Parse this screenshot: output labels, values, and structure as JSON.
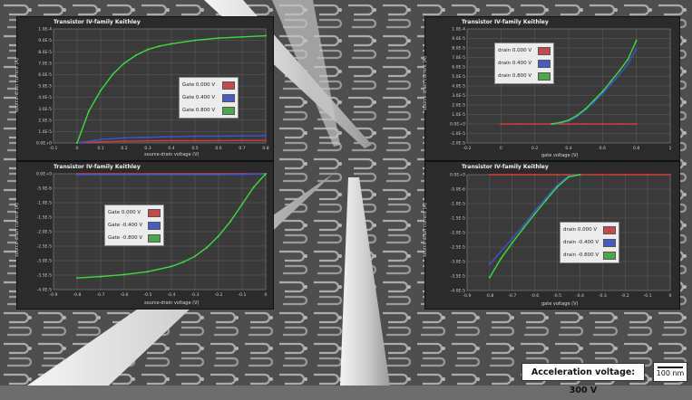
{
  "overlay": {
    "acceleration_label": "Acceleration voltage: 300 V",
    "scale_label": "100 nm"
  },
  "colors": {
    "red": "#d43a3a",
    "blue": "#3b55d6",
    "green": "#3ddc3d",
    "panel_bg": "#2b2b2b",
    "grid": "#6a6a6a"
  },
  "chart_data": [
    {
      "type": "scatter",
      "title": "Transistor IV-family Keithley",
      "xlabel": "source-drain voltage (V)",
      "ylabel": "source-drain current (A)",
      "xlim": [
        -0.1,
        0.8
      ],
      "ylim": [
        0,
        0.0001
      ],
      "xticks": [
        "-0.1",
        "0",
        "0.1",
        "0.2",
        "0.3",
        "0.4",
        "0.5",
        "0.6",
        "0.7",
        "0.8"
      ],
      "yticks": [
        "0.0E+0",
        "1.0E-5",
        "2.0E-5",
        "3.0E-5",
        "4.0E-5",
        "5.0E-5",
        "6.0E-5",
        "7.0E-5",
        "8.0E-5",
        "9.0E-5",
        "1.0E-4"
      ],
      "legend_position": "center-right",
      "series": [
        {
          "name": "Gate 0.000 V",
          "color": "red",
          "x": [
            0,
            0.1,
            0.2,
            0.3,
            0.4,
            0.5,
            0.6,
            0.7,
            0.8
          ],
          "y": [
            0,
            1e-06,
            1.5e-06,
            1.8e-06,
            2e-06,
            2e-06,
            2.1e-06,
            2.2e-06,
            2.2e-06
          ]
        },
        {
          "name": "Gate 0.400 V",
          "color": "blue",
          "x": [
            0,
            0.1,
            0.2,
            0.3,
            0.4,
            0.5,
            0.6,
            0.7,
            0.8
          ],
          "y": [
            0,
            3e-06,
            4.5e-06,
            5e-06,
            5.5e-06,
            6e-06,
            6e-06,
            6.2e-06,
            6.4e-06
          ]
        },
        {
          "name": "Gate 0.800 V",
          "color": "green",
          "x": [
            0,
            0.05,
            0.1,
            0.15,
            0.2,
            0.25,
            0.3,
            0.35,
            0.4,
            0.5,
            0.6,
            0.7,
            0.8
          ],
          "y": [
            0,
            2.8e-05,
            4.6e-05,
            6e-05,
            7e-05,
            7.7e-05,
            8.2e-05,
            8.5e-05,
            8.7e-05,
            9e-05,
            9.2e-05,
            9.3e-05,
            9.4e-05
          ]
        }
      ]
    },
    {
      "type": "scatter",
      "title": "Transistor IV-family Keithley",
      "xlabel": "gate voltage (V)",
      "ylabel": "source-drain current (A)",
      "xlim": [
        -0.2,
        1
      ],
      "ylim": [
        -2e-05,
        0.0001
      ],
      "xticks": [
        "-0.2",
        "0",
        "0.2",
        "0.4",
        "0.6",
        "0.8",
        "1"
      ],
      "yticks": [
        "-2.0E-5",
        "-1.0E-5",
        "0.0E+0",
        "1.0E-5",
        "2.0E-5",
        "3.0E-5",
        "4.0E-5",
        "5.0E-5",
        "6.0E-5",
        "7.0E-5",
        "8.0E-5",
        "9.0E-5",
        "1.0E-4"
      ],
      "legend_position": "top-left",
      "series": [
        {
          "name": "drain 0.000 V",
          "color": "red",
          "x": [
            0,
            0.1,
            0.2,
            0.3,
            0.4,
            0.5,
            0.6,
            0.7,
            0.8
          ],
          "y": [
            0,
            0,
            0,
            0,
            0,
            0,
            0,
            0,
            0
          ]
        },
        {
          "name": "drain 0.400 V",
          "color": "blue",
          "x": [
            0.3,
            0.35,
            0.4,
            0.45,
            0.5,
            0.55,
            0.6,
            0.65,
            0.7,
            0.75,
            0.8
          ],
          "y": [
            0,
            1e-06,
            3e-06,
            8e-06,
            1.5e-05,
            2.3e-05,
            3.2e-05,
            4.2e-05,
            5.2e-05,
            6.3e-05,
            7.9e-05
          ]
        },
        {
          "name": "drain 0.800 V",
          "color": "green",
          "x": [
            0.3,
            0.35,
            0.4,
            0.45,
            0.5,
            0.55,
            0.6,
            0.65,
            0.7,
            0.75,
            0.8
          ],
          "y": [
            0,
            1.5e-06,
            4e-06,
            9e-06,
            1.6e-05,
            2.5e-05,
            3.4e-05,
            4.5e-05,
            5.6e-05,
            6.8e-05,
            8.8e-05
          ]
        }
      ]
    },
    {
      "type": "scatter",
      "title": "Transistor IV-family Keithley",
      "xlabel": "source-drain voltage (V)",
      "ylabel": "source-drain current (A)",
      "xlim": [
        -0.9,
        0
      ],
      "ylim": [
        -4e-05,
        0
      ],
      "xticks": [
        "-0.9",
        "-0.8",
        "-0.7",
        "-0.6",
        "-0.5",
        "-0.4",
        "-0.3",
        "-0.2",
        "-0.1",
        "0"
      ],
      "yticks": [
        "-4.0E-5",
        "-3.5E-5",
        "-3.0E-5",
        "-2.5E-5",
        "-2.0E-5",
        "-1.5E-5",
        "-1.0E-5",
        "-5.0E-6",
        "0.0E+0"
      ],
      "legend_position": "top-left",
      "series": [
        {
          "name": "Gate 0.000 V",
          "color": "red",
          "x": [
            -0.8,
            -0.7,
            -0.6,
            -0.5,
            -0.4,
            -0.3,
            -0.2,
            -0.1,
            0
          ],
          "y": [
            0,
            0,
            0,
            0,
            0,
            0,
            0,
            0,
            0
          ]
        },
        {
          "name": "Gate -0.400 V",
          "color": "blue",
          "x": [
            -0.8,
            -0.7,
            -0.6,
            -0.5,
            -0.4,
            -0.3,
            -0.2,
            -0.1,
            0
          ],
          "y": [
            -3e-07,
            -3e-07,
            -3e-07,
            -3e-07,
            -3e-07,
            -3e-07,
            -3e-07,
            -2e-07,
            0
          ]
        },
        {
          "name": "Gate -0.800 V",
          "color": "green",
          "x": [
            -0.8,
            -0.7,
            -0.6,
            -0.5,
            -0.4,
            -0.35,
            -0.3,
            -0.25,
            -0.2,
            -0.15,
            -0.1,
            -0.05,
            0
          ],
          "y": [
            -3.6e-05,
            -3.55e-05,
            -3.48e-05,
            -3.38e-05,
            -3.2e-05,
            -3.05e-05,
            -2.85e-05,
            -2.55e-05,
            -2.15e-05,
            -1.65e-05,
            -1.05e-05,
            -4.5e-06,
            0
          ]
        }
      ]
    },
    {
      "type": "scatter",
      "title": "Transistor IV-family Keithley",
      "xlabel": "gate voltage (V)",
      "ylabel": "source-drain current (A)",
      "xlim": [
        -0.9,
        0
      ],
      "ylim": [
        -4e-05,
        0
      ],
      "xticks": [
        "-0.9",
        "-0.8",
        "-0.7",
        "-0.6",
        "-0.5",
        "-0.4",
        "-0.3",
        "-0.2",
        "-0.1",
        "0"
      ],
      "yticks": [
        "-4.0E-5",
        "-3.5E-5",
        "-3.0E-5",
        "-2.5E-5",
        "-2.0E-5",
        "-1.5E-5",
        "-1.0E-5",
        "-5.0E-6",
        "0.0E+0"
      ],
      "legend_position": "bottom-right",
      "series": [
        {
          "name": "drain 0.000 V",
          "color": "red",
          "x": [
            -0.8,
            -0.7,
            -0.6,
            -0.5,
            -0.4,
            -0.3,
            -0.2,
            -0.1,
            0
          ],
          "y": [
            0,
            0,
            0,
            0,
            0,
            0,
            0,
            0,
            0
          ]
        },
        {
          "name": "drain -0.400 V",
          "color": "blue",
          "x": [
            -0.8,
            -0.75,
            -0.7,
            -0.65,
            -0.6,
            -0.55,
            -0.5,
            -0.45,
            -0.4
          ],
          "y": [
            -3.1e-05,
            -2.65e-05,
            -2.2e-05,
            -1.75e-05,
            -1.25e-05,
            -8e-06,
            -3.5e-06,
            -5e-07,
            0
          ]
        },
        {
          "name": "drain -0.800 V",
          "color": "green",
          "x": [
            -0.8,
            -0.75,
            -0.7,
            -0.65,
            -0.6,
            -0.55,
            -0.5,
            -0.45,
            -0.4
          ],
          "y": [
            -3.55e-05,
            -2.9e-05,
            -2.35e-05,
            -1.85e-05,
            -1.35e-05,
            -8.8e-06,
            -4.2e-06,
            -8e-07,
            0
          ]
        }
      ]
    }
  ]
}
